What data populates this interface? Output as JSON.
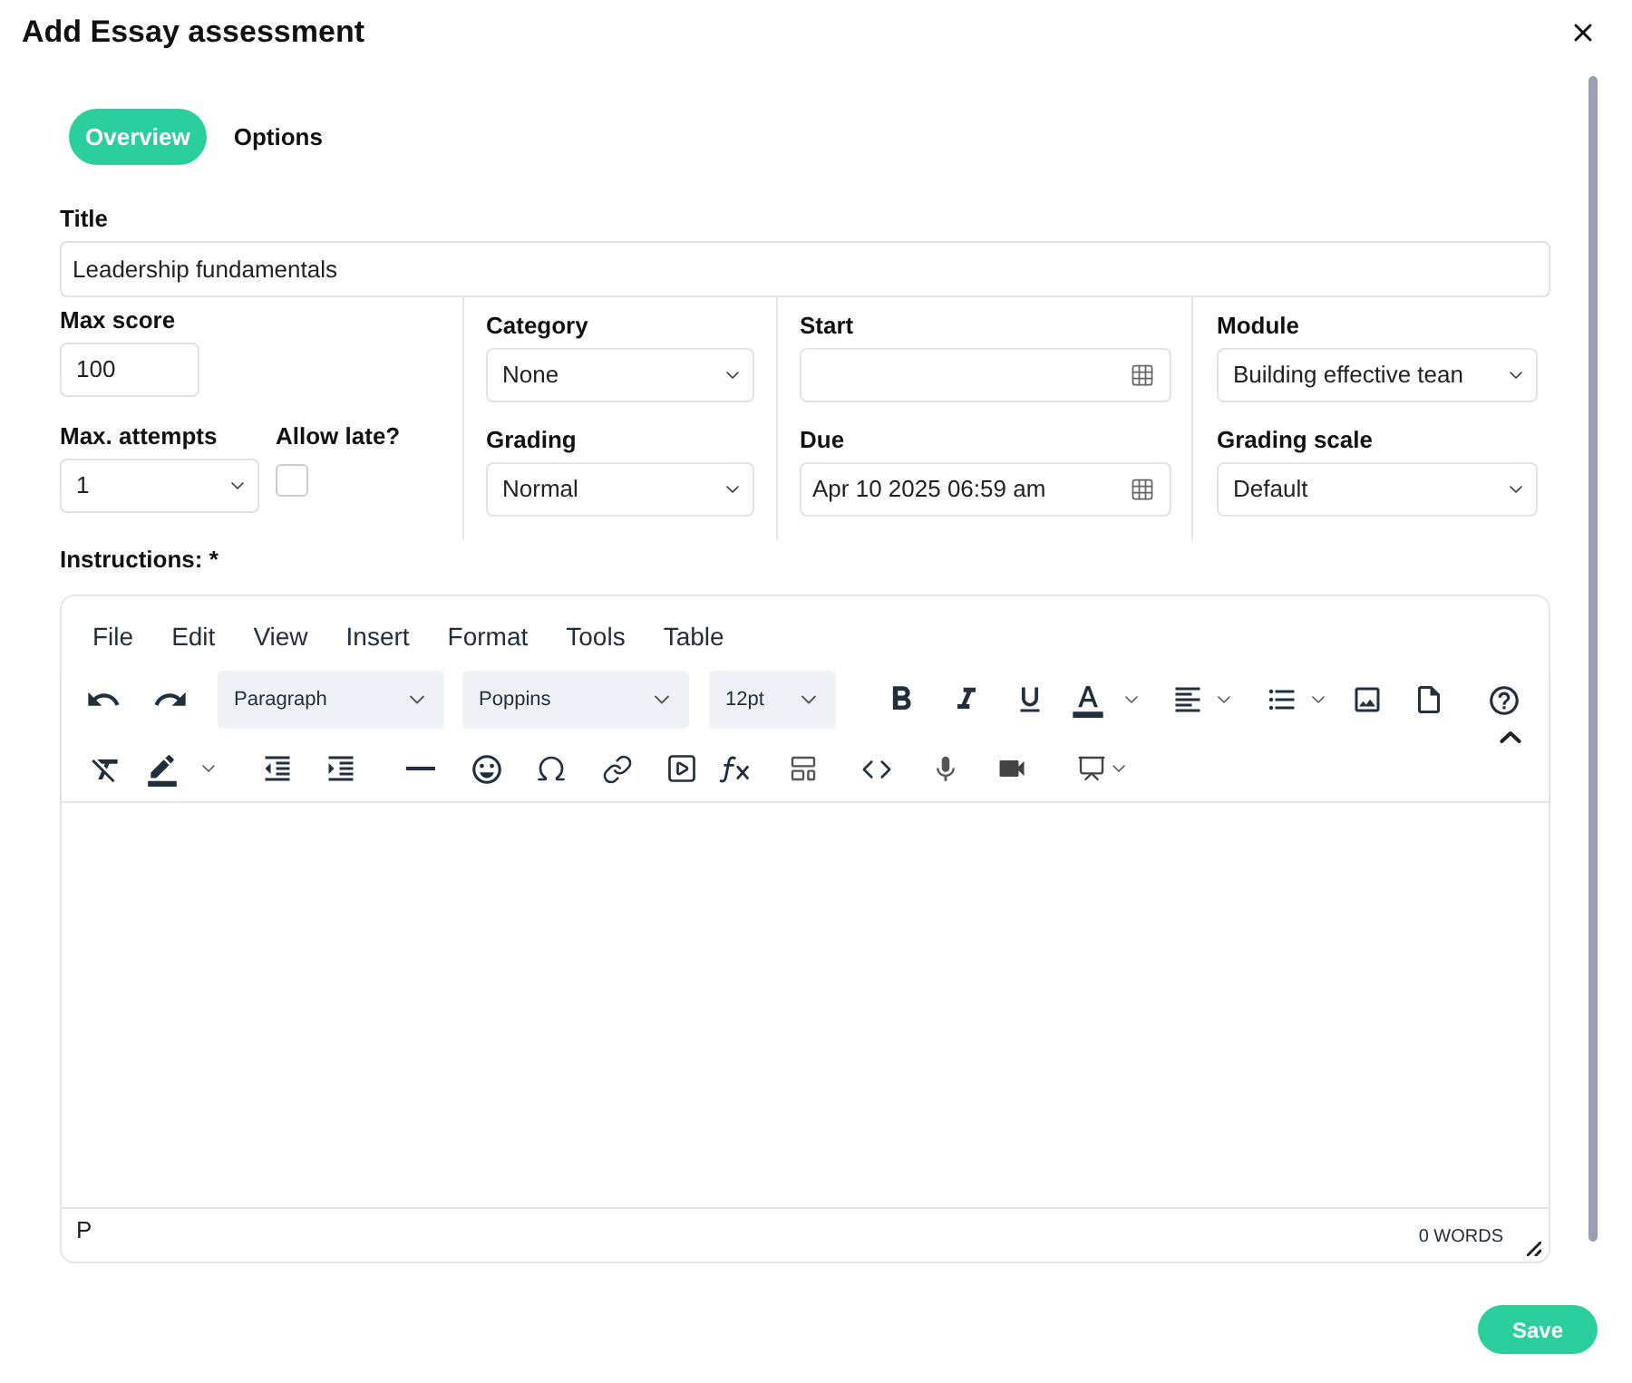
{
  "dialog": {
    "title": "Add Essay assessment"
  },
  "tabs": [
    {
      "label": "Overview",
      "selected": true
    },
    {
      "label": "Options",
      "selected": false
    }
  ],
  "title_field": {
    "label": "Title",
    "value": "Leadership fundamentals"
  },
  "columns": [
    {
      "rows": [
        [
          {
            "kind": "text",
            "label": "Max score",
            "value": "100"
          }
        ],
        [
          {
            "kind": "select",
            "label": "Max. attempts",
            "value": "1"
          },
          {
            "kind": "checkbox",
            "label": "Allow late?",
            "checked": false
          }
        ]
      ]
    },
    {
      "rows": [
        [
          {
            "kind": "select",
            "label": "Category",
            "value": "None"
          }
        ],
        [
          {
            "kind": "select",
            "label": "Grading",
            "value": "Normal"
          }
        ]
      ]
    },
    {
      "rows": [
        [
          {
            "kind": "date",
            "label": "Start"
          }
        ],
        [
          {
            "kind": "date",
            "label": "Due",
            "value": "Apr 10 2025 06:59 am"
          }
        ]
      ]
    },
    {
      "rows": [
        [
          {
            "kind": "select",
            "label": "Module",
            "value": "Building effective tean"
          }
        ],
        [
          {
            "kind": "select",
            "label": "Grading scale",
            "value": "Default"
          }
        ]
      ]
    }
  ],
  "instructions": {
    "label": "Instructions: *",
    "menu": [
      "File",
      "Edit",
      "View",
      "Insert",
      "Format",
      "Tools",
      "Table"
    ],
    "toolbar_selects": [
      "Paragraph",
      "Poppins",
      "12pt"
    ],
    "element_path": "P",
    "word_count": "0 WORDS"
  },
  "buttons": [
    {
      "label": "Save"
    }
  ]
}
